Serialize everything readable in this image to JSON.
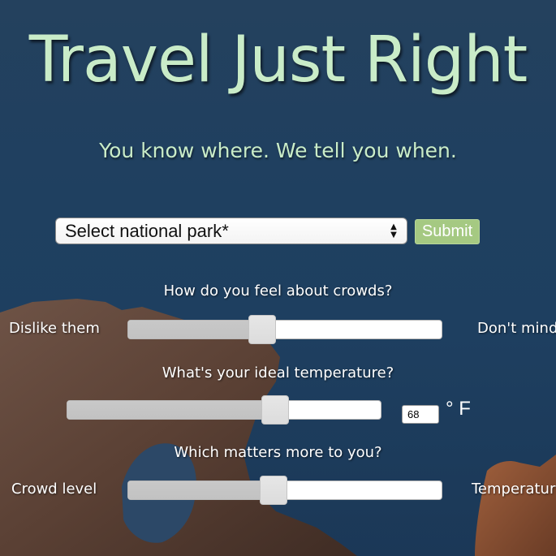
{
  "header": {
    "title": "Travel Just Right",
    "subtitle": "You know where. We tell you when."
  },
  "search": {
    "park_select_value": "Select national park*",
    "submit_label": "Submit"
  },
  "questions": {
    "crowds": {
      "question": "How do you feel about crowds?",
      "left_label": "Dislike them",
      "right_label": "Don't mind",
      "value_fraction": 0.42
    },
    "temperature": {
      "question": "What's your ideal temperature?",
      "value": "68",
      "unit": "° F",
      "value_fraction": 0.68
    },
    "priority": {
      "question": "Which matters more to you?",
      "left_label": "Crowd level",
      "right_label": "Temperature",
      "value_fraction": 0.46
    }
  },
  "colors": {
    "title_text": "#c9ecc8",
    "submit_bg": "#a5c982",
    "background": "#1f4060"
  }
}
